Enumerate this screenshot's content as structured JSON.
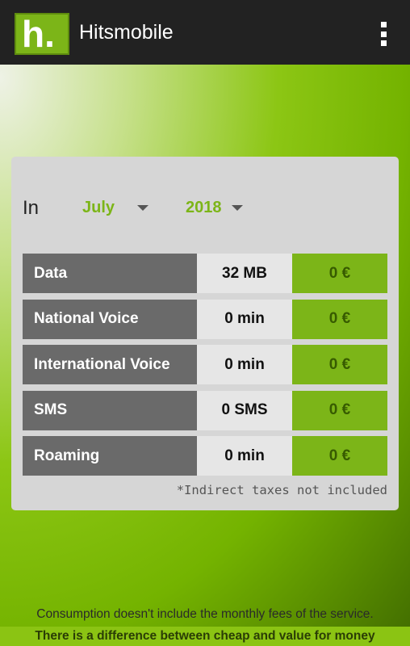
{
  "app": {
    "title": "Hitsmobile",
    "logo_text": "h."
  },
  "filter": {
    "in_label": "In",
    "month": "July",
    "year": "2018"
  },
  "usage": [
    {
      "label": "Data",
      "amount": "32 MB",
      "price": "0 €"
    },
    {
      "label": "National Voice",
      "amount": "0 min",
      "price": "0 €"
    },
    {
      "label": "International Voice",
      "amount": "0 min",
      "price": "0 €"
    },
    {
      "label": "SMS",
      "amount": "0 SMS",
      "price": "0 €"
    },
    {
      "label": "Roaming",
      "amount": "0 min",
      "price": "0 €"
    }
  ],
  "taxes_note": "*Indirect taxes not included",
  "footer_note": "Consumption doesn't include the monthly fees of the service.",
  "slogan": "There is a difference between cheap and value for money",
  "colors": {
    "brand_green": "#7cb518",
    "appbar": "#222222",
    "label_cell": "#6a6a6a",
    "amount_cell": "#e6e6e6"
  },
  "icons": {
    "logo": "hitsmobile-logo-icon",
    "menu": "overflow-menu-icon",
    "dropdown": "caret-down-icon"
  }
}
